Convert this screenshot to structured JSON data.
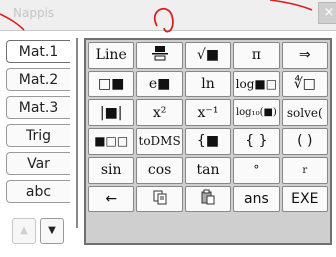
{
  "window": {
    "title": "Nappis",
    "close_label": "×"
  },
  "sidebar": {
    "tabs": [
      {
        "label": "Mat.1",
        "selected": true
      },
      {
        "label": "Mat.2",
        "selected": false
      },
      {
        "label": "Mat.3",
        "selected": false
      },
      {
        "label": "Trig",
        "selected": false
      },
      {
        "label": "Var",
        "selected": false
      },
      {
        "label": "abc",
        "selected": false
      }
    ],
    "scroll_up": "▲",
    "scroll_down": "▼"
  },
  "keypad": {
    "rows": [
      [
        "Line",
        "frac-icon",
        "√■",
        "π",
        "⇒"
      ],
      [
        "□■",
        "e■",
        "ln",
        "log■□",
        "∜□"
      ],
      [
        "|■|",
        "x²",
        "x⁻¹",
        "log₁₀(■)",
        "solve("
      ],
      [
        "■□□",
        "toDMS",
        "{■",
        "{ }",
        "( )"
      ],
      [
        "sin",
        "cos",
        "tan",
        "°",
        "r"
      ],
      [
        "←",
        "copy-icon",
        "paste-icon",
        "ans",
        "EXE"
      ]
    ]
  },
  "colors": {
    "annotation": "#d62020",
    "accent": "#707070"
  }
}
